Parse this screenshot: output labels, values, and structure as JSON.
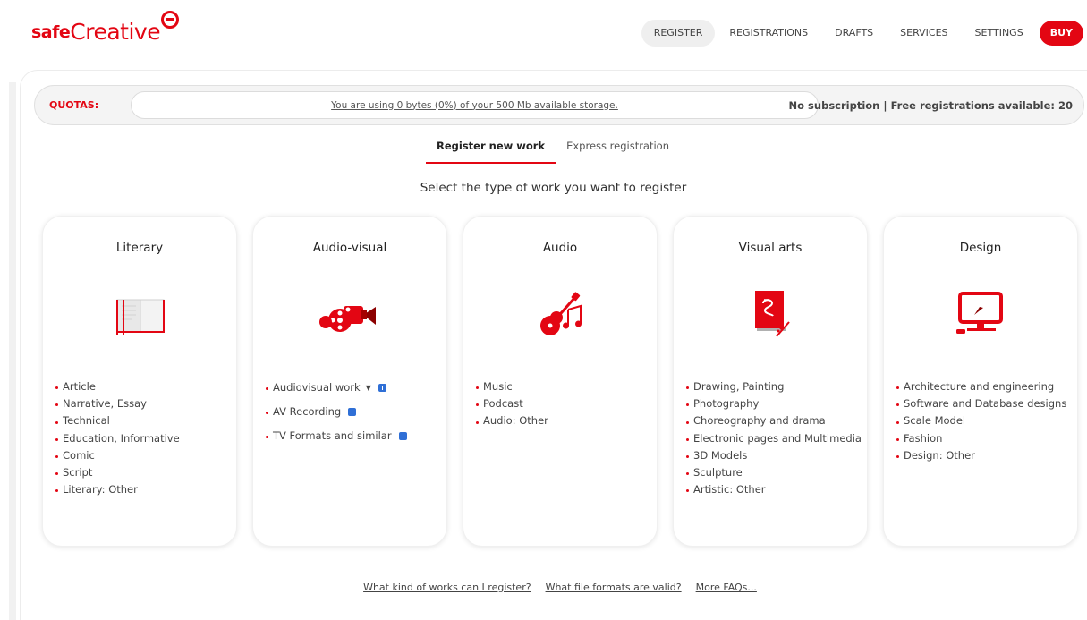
{
  "header": {
    "logo_safe": "safe",
    "logo_creative": "Creative",
    "nav": [
      {
        "label": "REGISTER",
        "active": true
      },
      {
        "label": "REGISTRATIONS",
        "active": false
      },
      {
        "label": "DRAFTS",
        "active": false
      },
      {
        "label": "SERVICES",
        "active": false
      },
      {
        "label": "SETTINGS",
        "active": false
      }
    ],
    "buy_label": "BUY"
  },
  "quotas": {
    "label": "QUOTAS:",
    "storage_text": "You are using 0 bytes (0%) of your 500 Mb available storage.",
    "storage_percent": 0,
    "subscription_text": "No subscription | Free registrations available: 20"
  },
  "tabs": [
    {
      "label": "Register new work",
      "active": true
    },
    {
      "label": "Express registration",
      "active": false
    }
  ],
  "subtitle": "Select the type of work you want to register",
  "cards": [
    {
      "title": "Literary",
      "icon": "book-icon",
      "items": [
        "Article",
        "Narrative, Essay",
        "Technical",
        "Education, Informative",
        "Comic",
        "Script",
        "Literary: Other"
      ]
    },
    {
      "title": "Audio-visual",
      "icon": "film-camera-icon",
      "items": [
        "Audiovisual work",
        "AV Recording",
        "TV Formats and similar"
      ]
    },
    {
      "title": "Audio",
      "icon": "guitar-music-icon",
      "items": [
        "Music",
        "Podcast",
        "Audio: Other"
      ]
    },
    {
      "title": "Visual arts",
      "icon": "painting-canvas-icon",
      "items": [
        "Drawing, Painting",
        "Photography",
        "Choreography and drama",
        "Electronic pages and Multimedia",
        "3D Models",
        "Sculpture",
        "Artistic: Other"
      ]
    },
    {
      "title": "Design",
      "icon": "monitor-cursor-icon",
      "items": [
        "Architecture and engineering",
        "Software and Database designs",
        "Scale Model",
        "Fashion",
        "Design: Other"
      ]
    }
  ],
  "faq_links": [
    "What kind of works can I register?",
    "What file formats are valid?",
    "More FAQs..."
  ],
  "colors": {
    "brand": "#e30613",
    "info": "#2f6fd6"
  }
}
